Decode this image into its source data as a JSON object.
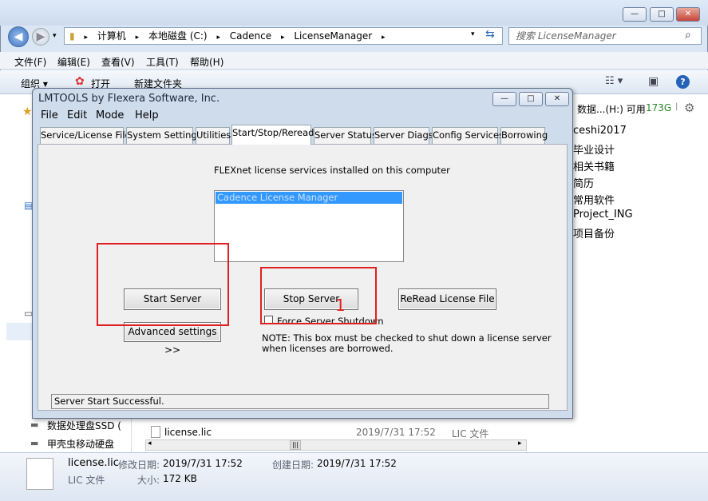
{
  "explorer": {
    "caption_buttons": {
      "minimize": "—",
      "maximize": "□",
      "close": "✕"
    },
    "breadcrumb": [
      "计算机",
      "本地磁盘 (C:)",
      "Cadence",
      "LicenseManager"
    ],
    "search_placeholder": "搜索 LicenseManager",
    "menu": [
      "文件(F)",
      "编辑(E)",
      "查看(V)",
      "工具(T)",
      "帮助(H)"
    ],
    "toolbar": {
      "organize": "组织 ▾",
      "open": "打开",
      "new_folder": "新建文件夹"
    },
    "right_panel": {
      "drive_label": "数据...(H:) 可用",
      "drive_free": "173G",
      "folders": [
        "ceshi2017",
        "毕业设计",
        "相关书籍",
        "简历",
        "常用软件",
        "Project_ING",
        "项目备份"
      ]
    },
    "nav_items": [
      "数据处理盘SSD (",
      "甲壳虫移动硬盘"
    ],
    "file_row": {
      "name": "license.lic",
      "date": "2019/7/31 17:52",
      "type": "LIC 文件"
    },
    "details": {
      "filename": "license.lic",
      "modified_label": "修改日期:",
      "modified_value": "2019/7/31 17:52",
      "created_label": "创建日期:",
      "created_value": "2019/7/31 17:52",
      "type": "LIC 文件",
      "size_label": "大小:",
      "size_value": "172 KB"
    }
  },
  "lmtools": {
    "title": "LMTOOLS by Flexera Software, Inc.",
    "menu": [
      "File",
      "Edit",
      "Mode",
      "Help"
    ],
    "tabs": [
      "Service/License File",
      "System Settings",
      "Utilities",
      "Start/Stop/Reread",
      "Server Status",
      "Server Diags",
      "Config Services",
      "Borrowing"
    ],
    "active_tab": "Start/Stop/Reread",
    "services_label": "FLEXnet license services installed on this computer",
    "services": [
      "Cadence License Manager"
    ],
    "buttons": {
      "start": "Start Server",
      "stop": "Stop Server",
      "reread": "ReRead License File",
      "advanced": "Advanced settings >>"
    },
    "force_shutdown_label": "Force Server Shutdown",
    "force_shutdown_checked": false,
    "note_line1": "NOTE:  This box must be checked to shut down a license server",
    "note_line2": "when licenses are borrowed.",
    "status": "Server Start Successful."
  },
  "annotation": {
    "number": "1",
    "color": "#e02020"
  }
}
